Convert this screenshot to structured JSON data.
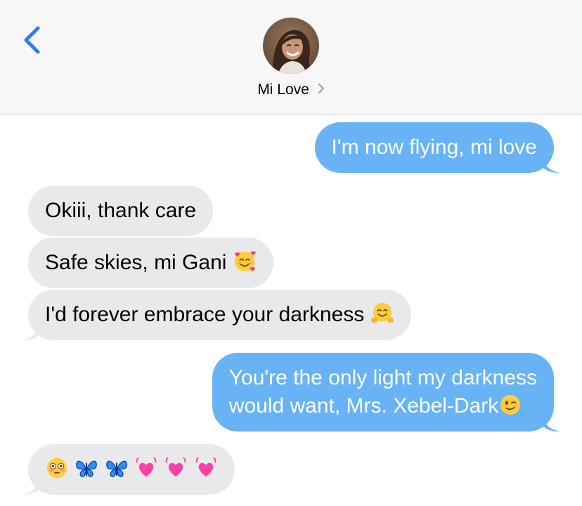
{
  "header": {
    "contact_name": "Mi Love",
    "back_icon": "chevron-left-icon",
    "name_chevron_icon": "chevron-right-icon"
  },
  "colors": {
    "sent_bubble": "#67b3f5",
    "received_bubble": "#e9e9eb",
    "header_bg": "#f7f7f7",
    "accent": "#2f7cf6"
  },
  "messages": [
    {
      "direction": "sent",
      "text": "I'm now flying, mi love",
      "emoji": ""
    },
    {
      "direction": "received",
      "text": "Okiii, thank care",
      "emoji": ""
    },
    {
      "direction": "received",
      "text": "Safe skies, mi Gani",
      "emoji": "smiling-face-with-hearts"
    },
    {
      "direction": "received",
      "text": "I'd forever embrace your darkness",
      "emoji": "hugging-face"
    },
    {
      "direction": "sent",
      "line1": "You're the only light my darkness",
      "line2": "would want, Mrs. Xebel-Dark",
      "emoji": "winking-face"
    },
    {
      "direction": "received",
      "text": "",
      "emojis": [
        "flushed-face",
        "blue-butterfly",
        "blue-butterfly",
        "beating-heart",
        "beating-heart",
        "beating-heart"
      ]
    }
  ]
}
